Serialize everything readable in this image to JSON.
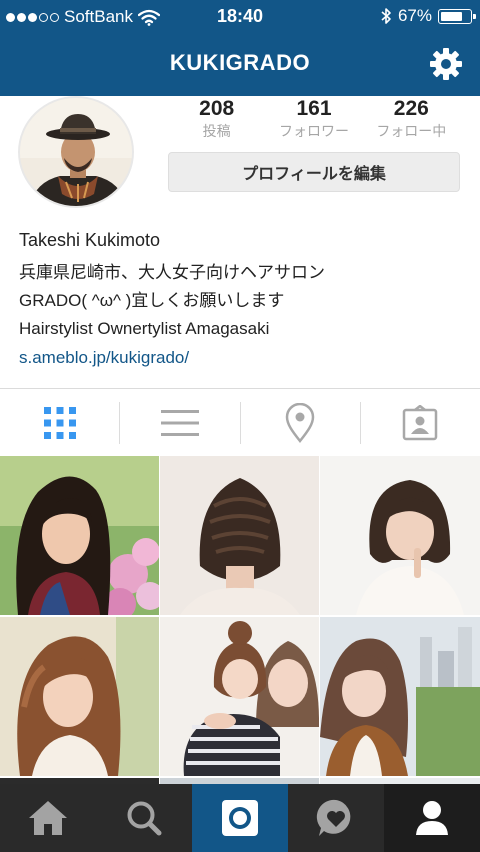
{
  "status_bar": {
    "carrier": "SoftBank",
    "time": "18:40",
    "battery": "67%",
    "battery_level": 0.67
  },
  "header": {
    "title": "KUKIGRADO"
  },
  "profile": {
    "stats": [
      {
        "value": "208",
        "label": "投稿"
      },
      {
        "value": "161",
        "label": "フォロワー"
      },
      {
        "value": "226",
        "label": "フォロー中"
      }
    ],
    "edit_button": "プロフィールを編集",
    "name": "Takeshi Kukimoto",
    "bio_lines": [
      "兵庫県尼崎市、大人女子向けヘアサロン",
      "GRADO( ^ω^ )宜しくお願いします",
      "Hairstylist Ownertylist Amagasaki"
    ],
    "link": "s.ameblo.jp/kukigrado/"
  },
  "view_tabs": [
    {
      "icon": "grid-icon",
      "active": true
    },
    {
      "icon": "list-icon",
      "active": false
    },
    {
      "icon": "location-pin-icon",
      "active": false
    },
    {
      "icon": "tagged-photos-icon",
      "active": false
    }
  ],
  "bottom_tabs": [
    {
      "icon": "home-icon"
    },
    {
      "icon": "search-icon"
    },
    {
      "icon": "camera-icon"
    },
    {
      "icon": "activity-heart-icon"
    },
    {
      "icon": "profile-icon"
    }
  ],
  "colors": {
    "header_bg": "#125688",
    "link": "#125688",
    "active_tab": "#3897f0",
    "inactive_tab": "#a8a8a8",
    "tabbar_bg": "#2a2a2a"
  }
}
